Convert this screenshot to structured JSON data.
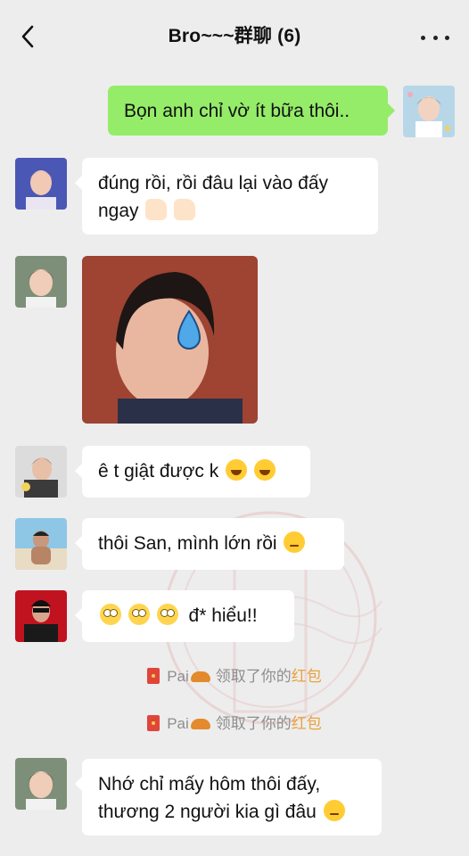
{
  "header": {
    "title": "Bro~~~群聊 (6)",
    "back_icon": "chevron-left-icon",
    "more_icon": "more-dots-icon"
  },
  "messages": [
    {
      "side": "right",
      "type": "text",
      "text": "Bọn anh chỉ vờ ít bữa thôi.."
    },
    {
      "side": "left",
      "type": "text",
      "line1": "đúng rồi, rồi đâu lại vào đấy",
      "line2": "ngay",
      "emojis": [
        "thumbs-up-icon",
        "thumbs-up-icon"
      ]
    },
    {
      "side": "left",
      "type": "sticker",
      "sticker_icon": "sweat-drop-sticker"
    },
    {
      "side": "left",
      "type": "text",
      "text": "ê t giật được k",
      "emojis": [
        "rofl-emoji-icon",
        "rofl-emoji-icon"
      ]
    },
    {
      "side": "left",
      "type": "text",
      "text": "thôi San, mình lớn rồi",
      "emojis": [
        "unamused-emoji-icon"
      ]
    },
    {
      "side": "left",
      "type": "text",
      "text": "đ* hiểu!!",
      "emojis": [
        "eye-roll-emoji-icon",
        "eye-roll-emoji-icon",
        "eye-roll-emoji-icon"
      ]
    },
    {
      "type": "system",
      "name": "Pai",
      "action": "领取了你的",
      "link": "红包"
    },
    {
      "type": "system",
      "name": "Pai",
      "action": "领取了你的",
      "link": "红包"
    },
    {
      "side": "left",
      "type": "text",
      "line1": "Nhớ chỉ mấy hôm thôi đấy,",
      "line2": "thương 2 người kia gì đâu",
      "emojis": [
        "sad-emoji-icon"
      ]
    }
  ],
  "watermark": {
    "text": "微图截图助"
  },
  "colors": {
    "background": "#ededed",
    "bubble_self": "#95ec69",
    "bubble_other": "#ffffff",
    "red_packet_link": "#e9a23b"
  }
}
